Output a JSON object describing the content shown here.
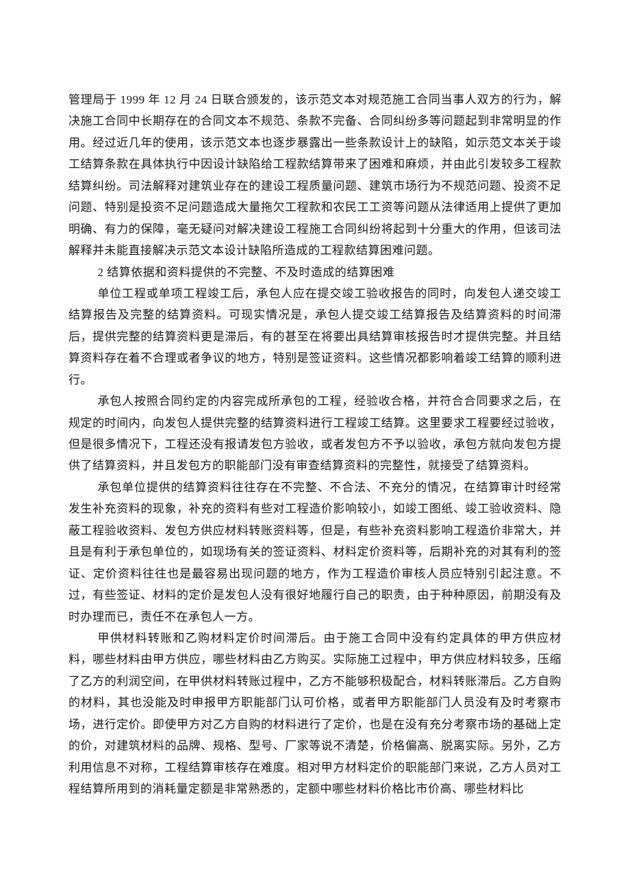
{
  "paragraphs": [
    {
      "indent": false,
      "text": "管理局于 1999 年 12 月 24 日联合颁发的，该示范文本对规范施工合同当事人双方的行为，解决施工合同中长期存在的合同文本不规范、条款不完备、合同纠纷多等问题起到非常明显的作用。经过近几年的使用，该示范文本也逐步暴露出一些条款设计上的缺陷，如示范文本关于竣工结算条款在具体执行中因设计缺陷给工程款结算带来了困难和麻烦，并由此引发较多工程款结算纠纷。司法解释对建筑业存在的建设工程质量问题、建筑市场行为不规范问题、投资不足问题、特别是投资不足问题造成大量拖欠工程款和农民工工资等问题从法律适用上提供了更加明确、有力的保障，毫无疑问对解决建设工程施工合同纠纷将起到十分重大的作用，但该司法解释并未能直接解决示范文本设计缺陷所造成的工程款结算困难问题。"
    },
    {
      "indent": true,
      "text": "2 结算依据和资料提供的不完整、不及时造成的结算困难"
    },
    {
      "indent": true,
      "text": "单位工程或单项工程竣工后，承包人应在提交竣工验收报告的同时，向发包人递交竣工结算报告及完整的结算资料。可现实情况是，承包人提交竣工结算报告及结算资料的时间滞后，提供完整的结算资料更是滞后，有的甚至在将要出具结算审核报告时才提供完整。并且结算资料存在着不合理或者争议的地方，特别是签证资料。这些情况都影响着竣工结算的顺利进行。"
    },
    {
      "indent": true,
      "text": "承包人按照合同约定的内容完成所承包的工程，经验收合格，并符合合同要求之后，在规定的时间内，向发包人提供完整的结算资料进行工程竣工结算。这里要求工程要经过验收，但是很多情况下，工程还没有报请发包方验收，或者发包方不予以验收，承包方就向发包方提供了结算资料，并且发包方的职能部门没有审查结算资料的完整性，就接受了结算资料。"
    },
    {
      "indent": true,
      "text": "承包单位提供的结算资料往往存在不完整、不合法、不充分的情况，在结算审计时经常发生补充资料的现象，补充的资料有些对工程造价影响较小，如竣工图纸、竣工验收资料、隐蔽工程验收资料、发包方供应材料转账资料等，但是，有些补充资料影响工程造价非常大，并且是有利于承包单位的，如现场有关的签证资料、材料定价资料等，后期补充的对其有利的签证、定价资料往往也是最容易出现问题的地方，作为工程造价审核人员应特别引起注意。不过，有些签证、材料的定价是发包人没有很好地履行自己的职责，由于种种原因，前期没有及时办理而已，责任不在承包人一方。"
    },
    {
      "indent": true,
      "text": "甲供材料转账和乙购材料定价时间滞后。由于施工合同中没有约定具体的甲方供应材料，哪些材料由甲方供应，哪些材料由乙方购买。实际施工过程中，甲方供应材料较多，压缩了乙方的利润空间，在甲供材料转账过程中，乙方不能够积极配合，材料转账滞后。乙方自购的材料，其也没能及时申报甲方职能部门认可价格，或者甲方职能部门人员没有及时考察市场，进行定价。即使甲方对乙方自购的材料进行了定价，也是在没有充分考察市场的基础上定的价，对建筑材料的品牌、规格、型号、厂家等说不清楚，价格偏高、脱离实际。另外，乙方利用信息不对称，工程结算审核存在难度。相对甲方材料定价的职能部门来说，乙方人员对工程结算所用到的消耗量定额是非常熟悉的，定额中哪些材料价格比市价高、哪些材料比"
    }
  ]
}
